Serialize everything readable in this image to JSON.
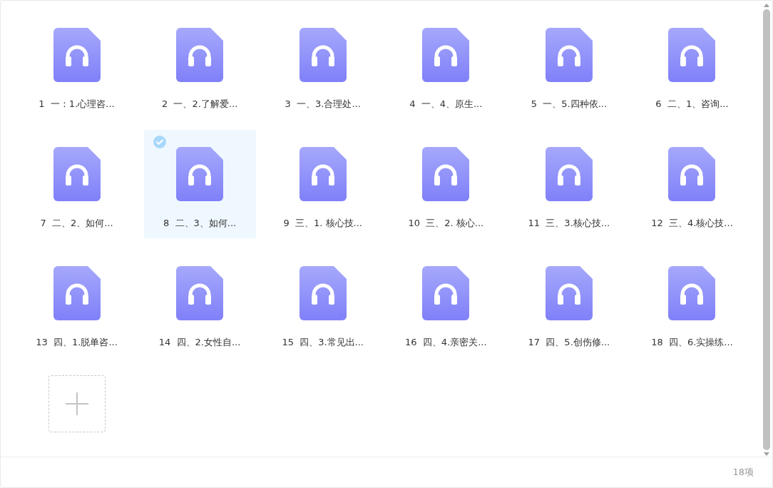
{
  "files": [
    {
      "label": "1 一：1.心理咨...",
      "selected": false
    },
    {
      "label": "2 一、2.了解爱...",
      "selected": false
    },
    {
      "label": "3 一、3.合理处...",
      "selected": false
    },
    {
      "label": "4 一、4、原生...",
      "selected": false
    },
    {
      "label": "5 一、5.四种依...",
      "selected": false
    },
    {
      "label": "6 二、1、咨询...",
      "selected": false
    },
    {
      "label": "7 二、2、如何...",
      "selected": false
    },
    {
      "label": "8 二、3、如何...",
      "selected": true
    },
    {
      "label": "9 三、1. 核心技...",
      "selected": false
    },
    {
      "label": "10 三、2. 核心...",
      "selected": false
    },
    {
      "label": "11 三、3.核心技...",
      "selected": false
    },
    {
      "label": "12 三、4.核心技...",
      "selected": false
    },
    {
      "label": "13 四、1.脱单咨...",
      "selected": false
    },
    {
      "label": "14 四、2.女性自...",
      "selected": false
    },
    {
      "label": "15 四、3.常见出...",
      "selected": false
    },
    {
      "label": "16 四、4.亲密关...",
      "selected": false
    },
    {
      "label": "17 四、5.创伤修...",
      "selected": false
    },
    {
      "label": "18 四、6.实操练...",
      "selected": false
    }
  ],
  "status_bar": {
    "count": "18项"
  }
}
